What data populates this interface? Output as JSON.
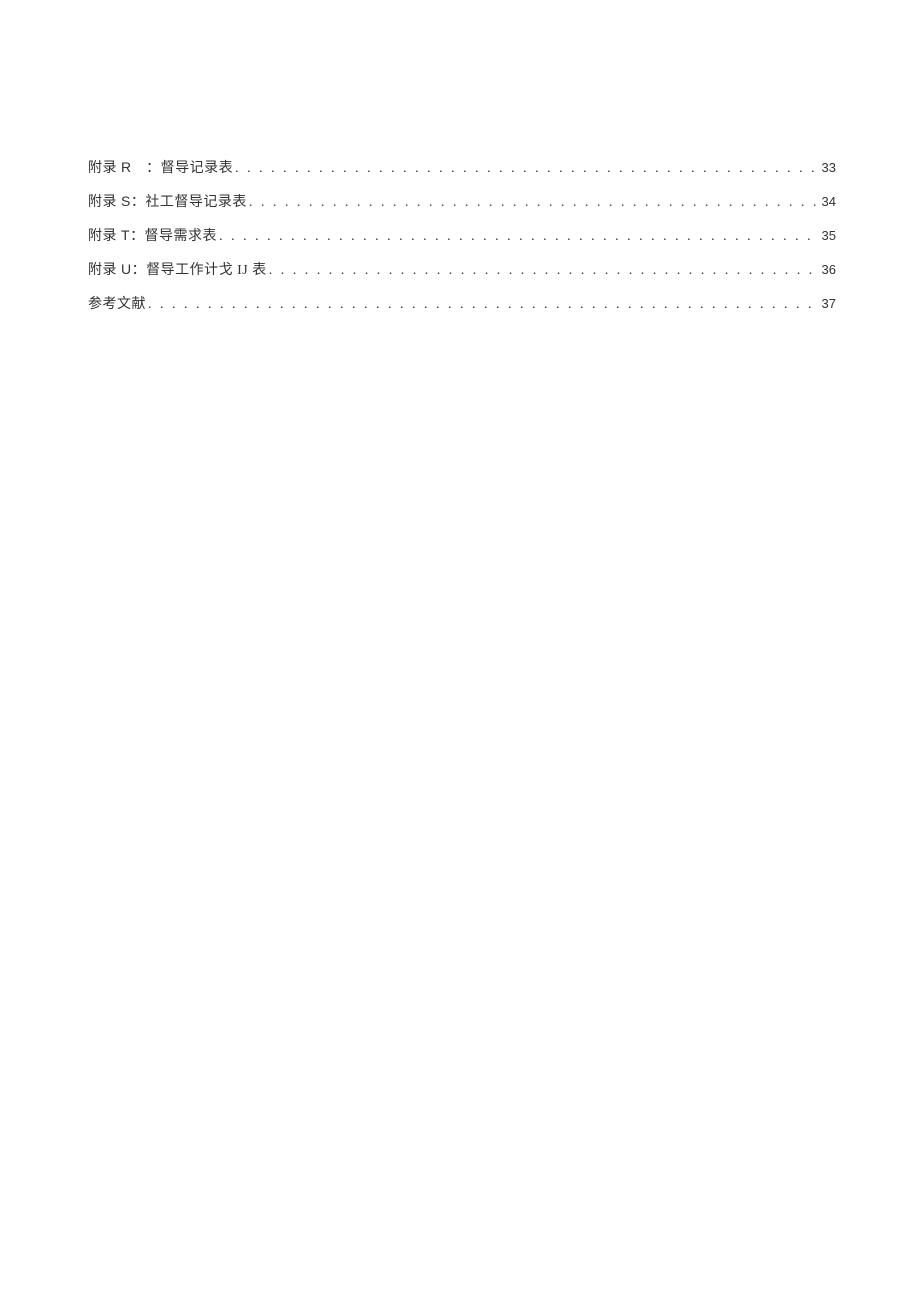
{
  "toc": [
    {
      "label_pre": "附录 ",
      "letter": "R",
      "label_post": " ：督导记录表",
      "page": "33"
    },
    {
      "label_pre": "附录 ",
      "letter": "S",
      "label_post": "：社工督导记录表",
      "page": "34"
    },
    {
      "label_pre": "附录 ",
      "letter": "T",
      "label_post": "：督导需求表",
      "page": "35"
    },
    {
      "label_pre": "附录 ",
      "letter": "U",
      "label_post": "：督导工作计戈 IJ 表",
      "page": "36"
    },
    {
      "label_pre": "参考文献",
      "letter": "",
      "label_post": "",
      "page": "37"
    }
  ],
  "dots": ". . . . . . . . . . . . . . . . . . . . . . . . . . . . . . . . . . . . . . . . . . . . . . . . . . . . . . . . . . . . . . . . . . . . . . . . . . . . . . . . . . . . . . . . . . . . . . . . . . . . . . . . . . . . . . . . . . . . . . . . . . . . . . . . . . . . . . . . . . . . . . . . . . . . . . . . . . . . . . . . . . . . . . . . . . . . . . . . . . . . . . . . . . . . . . . . . . . . . . . . . . . . . . . . . . . . . . . . . . . . . . . . . . . . . ."
}
